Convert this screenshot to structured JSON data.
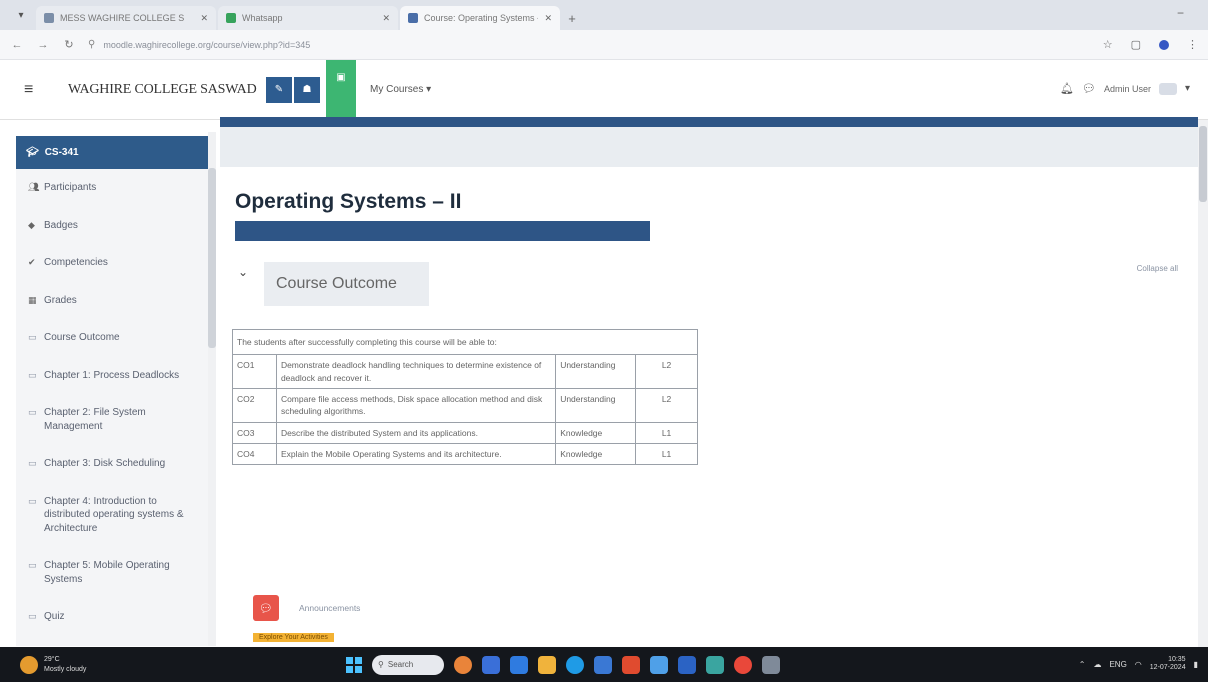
{
  "browser": {
    "tabs": [
      {
        "title": "MESS WAGHIRE COLLEGE S",
        "favicon_color": "#7b8ea8",
        "active": false
      },
      {
        "title": "Whatsapp",
        "favicon_color": "#37a35c",
        "active": false
      },
      {
        "title": "Course: Operating Systems - II",
        "favicon_color": "#4a6ea8",
        "active": true
      }
    ],
    "url": "moodle.waghirecollege.org/course/view.php?id=345",
    "new_tab": "+",
    "minimize": "−"
  },
  "navbar": {
    "site_name": "WAGHIRE COLLEGE SASWAD",
    "my_courses": "My Courses ▾",
    "user_name": "Admin User",
    "user_caret": "▾"
  },
  "sidebar": {
    "active": {
      "label": "CS-341",
      "icon": "graduation-cap-icon"
    },
    "items": [
      {
        "label": "Participants",
        "icon": "users-icon"
      },
      {
        "label": "Badges",
        "icon": "badge-icon"
      },
      {
        "label": "Competencies",
        "icon": "check-icon"
      },
      {
        "label": "Grades",
        "icon": "grades-icon"
      },
      {
        "label": "Course Outcome",
        "icon": "folder-icon"
      },
      {
        "label": "Chapter 1: Process Deadlocks",
        "icon": "folder-icon"
      },
      {
        "label": "Chapter 2: File System Management",
        "icon": "folder-icon"
      },
      {
        "label": "Chapter 3: Disk Scheduling",
        "icon": "folder-icon"
      },
      {
        "label": "Chapter 4: Introduction to distributed operating systems & Architecture",
        "icon": "folder-icon"
      },
      {
        "label": "Chapter 5: Mobile Operating Systems",
        "icon": "folder-icon"
      },
      {
        "label": "Quiz",
        "icon": "folder-icon"
      }
    ]
  },
  "main": {
    "course_title": "Operating Systems – II",
    "section_title": "Course Outcome",
    "collapse_all": "Collapse all",
    "table": {
      "intro": "The students after successfully completing this course will be able to:",
      "rows": [
        {
          "code": "CO1",
          "desc": "Demonstrate deadlock handling techniques to determine existence of deadlock and recover it.",
          "level": "Understanding",
          "bloom": "L2"
        },
        {
          "code": "CO2",
          "desc": "Compare file access methods, Disk space allocation method and disk scheduling algorithms.",
          "level": "Understanding",
          "bloom": "L2"
        },
        {
          "code": "CO3",
          "desc": "Describe the distributed System and its applications.",
          "level": "Knowledge",
          "bloom": "L1"
        },
        {
          "code": "CO4",
          "desc": "Explain the Mobile Operating Systems and its architecture.",
          "level": "Knowledge",
          "bloom": "L1"
        }
      ]
    },
    "activity": {
      "name": "Announcements",
      "badge": "Explore Your Activities"
    }
  },
  "taskbar": {
    "weather_temp": "29°C",
    "weather_desc": "Mostly cloudy",
    "search_placeholder": "Search",
    "clock_time": "10:35",
    "clock_date": "12-07-2024",
    "lang": "ENG"
  },
  "colors": {
    "primary": "#2e5586",
    "sidebar_active": "#2e5b8a",
    "green_button": "#3db672",
    "activity_icon": "#e8554a",
    "badge": "#f3b233"
  }
}
